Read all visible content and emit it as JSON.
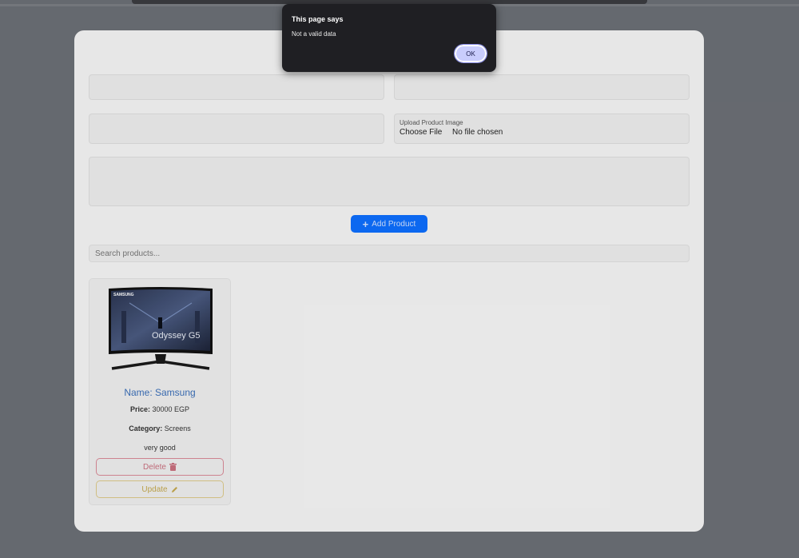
{
  "dialog": {
    "title": "This page says",
    "message": "Not a valid data",
    "ok_label": "OK"
  },
  "form": {
    "upload_label": "Upload Product Image",
    "choose_file_label": "Choose File",
    "no_file_text": "No file chosen",
    "add_button_label": "Add Product"
  },
  "search": {
    "placeholder": "Search products..."
  },
  "products": [
    {
      "name": "Name: Samsung",
      "price_label": "Price:",
      "price_value": "30000 EGP",
      "category_label": "Category:",
      "category_value": "Screens",
      "description": "very good",
      "image_brand_text": "SAMSUNG",
      "image_model_text": "Odyssey G5",
      "delete_label": "Delete",
      "update_label": "Update"
    }
  ],
  "colors": {
    "primary": "#0d6efd",
    "danger": "#dc3545",
    "warning": "#ffc107",
    "name_link": "#3b6fb8",
    "dialog_bg": "#1f1f23",
    "ok_button": "#c9cdfd"
  },
  "icons": {
    "add": "plus-icon",
    "delete": "trash-icon",
    "update": "pencil-icon"
  }
}
